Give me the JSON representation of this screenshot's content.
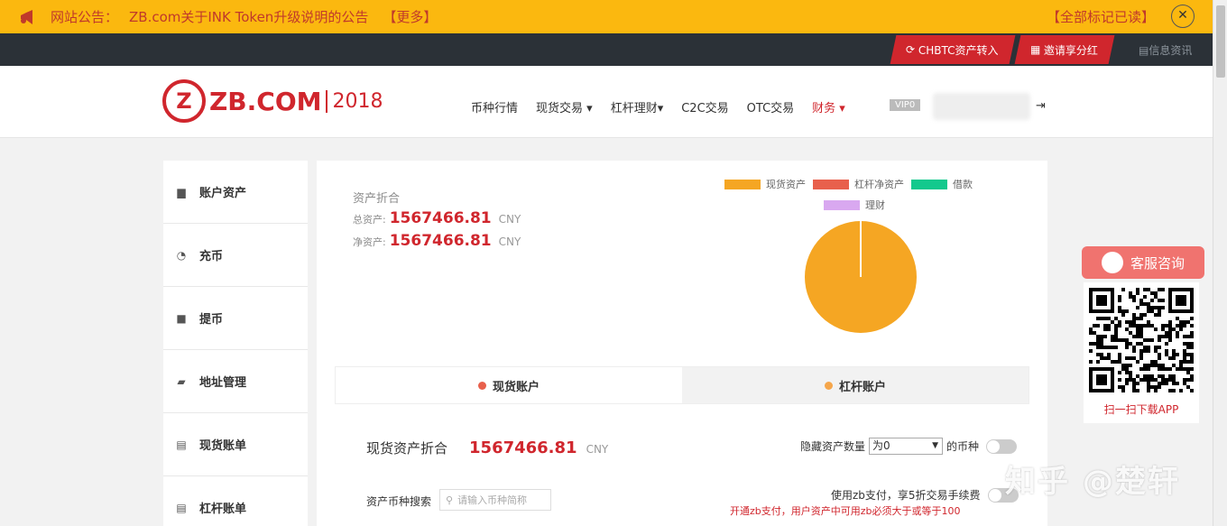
{
  "notice": {
    "label": "网站公告：",
    "text": "ZB.com关于INK Token升级说明的公告",
    "more": "【更多】",
    "mark_all": "【全部标记已读】",
    "close": "✕"
  },
  "topbar": {
    "chbtc": "CHBTC资产转入",
    "invite": "邀请享分红",
    "news": "信息资讯"
  },
  "header": {
    "logo_word": "ZB.COM",
    "logo_year": "2018",
    "nav": [
      {
        "label": "币种行情"
      },
      {
        "label": "现货交易 ▾"
      },
      {
        "label": "杠杆理财▾"
      },
      {
        "label": "C2C交易"
      },
      {
        "label": "OTC交易"
      },
      {
        "label": "财务 ▾"
      }
    ],
    "vip": "VIP0",
    "logout_icon": "logout-icon"
  },
  "sidebar": {
    "items": [
      {
        "label": "账户资产",
        "icon": "camera-icon"
      },
      {
        "label": "充币",
        "icon": "deposit-icon"
      },
      {
        "label": "提币",
        "icon": "briefcase-icon"
      },
      {
        "label": "地址管理",
        "icon": "wallet-icon"
      },
      {
        "label": "现货账单",
        "icon": "ledger-icon"
      },
      {
        "label": "杠杆账单",
        "icon": "ledger-icon"
      }
    ]
  },
  "summary": {
    "title": "资产折合",
    "total_label": "总资产:",
    "total_value": "1567466.81",
    "net_label": "净资产:",
    "net_value": "1567466.81",
    "currency": "CNY"
  },
  "chart_data": {
    "type": "pie",
    "title": "",
    "legend": [
      "现货资产",
      "杠杆净资产",
      "借款",
      "理财"
    ],
    "colors": [
      "#f5a623",
      "#e8604c",
      "#13c98d",
      "#d9a8f0"
    ],
    "values": [
      1567466.81,
      0,
      0,
      0
    ],
    "legend_position": "top"
  },
  "tabs": [
    {
      "label": "现货账户",
      "dot_color": "#e8604c"
    },
    {
      "label": "杠杆账户",
      "dot_color": "#f5a64b"
    }
  ],
  "spot": {
    "label": "现货资产折合",
    "value": "1567466.81",
    "currency": "CNY"
  },
  "hide_ctl": {
    "label": "隐藏资产数量",
    "select_value": "为0",
    "suffix": "的币种"
  },
  "search": {
    "label": "资产币种搜索",
    "placeholder": "请输入币种简称"
  },
  "zb_pay": {
    "label": "使用zb支付，享5折交易手续费",
    "note": "开通zb支付，用户资产中可用zb必须大于或等于100"
  },
  "service": {
    "button": "客服咨询",
    "scan": "扫一扫下载APP"
  },
  "watermark": "知乎 @楚轩"
}
